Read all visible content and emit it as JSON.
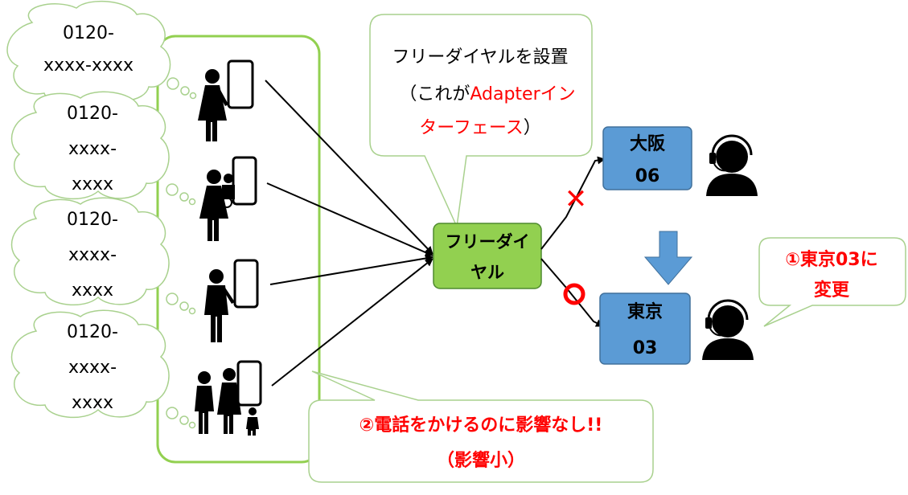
{
  "caller_bubbles": [
    {
      "lines": [
        "0120-",
        "xxxx-xxxx"
      ]
    },
    {
      "lines": [
        "0120-",
        "xxxx-",
        "xxxx"
      ]
    },
    {
      "lines": [
        "0120-",
        "xxxx-",
        "xxxx"
      ]
    },
    {
      "lines": [
        "0120-",
        "xxxx-",
        "xxxx"
      ]
    }
  ],
  "callout_top": {
    "line1": "フリーダイヤルを設置",
    "line2_a": "（これが",
    "line2_b": "Adapterイン",
    "line3_a": "ターフェース",
    "line3_b": "）"
  },
  "hub": {
    "line1": "フリーダイ",
    "line2": "ヤル"
  },
  "osaka": {
    "name": "大阪",
    "code": "06"
  },
  "tokyo": {
    "name": "東京",
    "code": "03"
  },
  "marks": {
    "cross": "✕",
    "circle": "○"
  },
  "callout_right": {
    "line1": "①東京03に",
    "line2": "変更"
  },
  "callout_bottom": {
    "line1": "②電話をかけるのに影響なし!!",
    "line2": "（影響小）"
  },
  "colors": {
    "green_border": "#92d050",
    "hub_fill": "#92d050",
    "box_fill": "#5b9bd5",
    "box_border": "#41719c",
    "red": "#ff0000",
    "callout_border": "#a9d18e",
    "arrow_fill": "#5b9bd5"
  }
}
